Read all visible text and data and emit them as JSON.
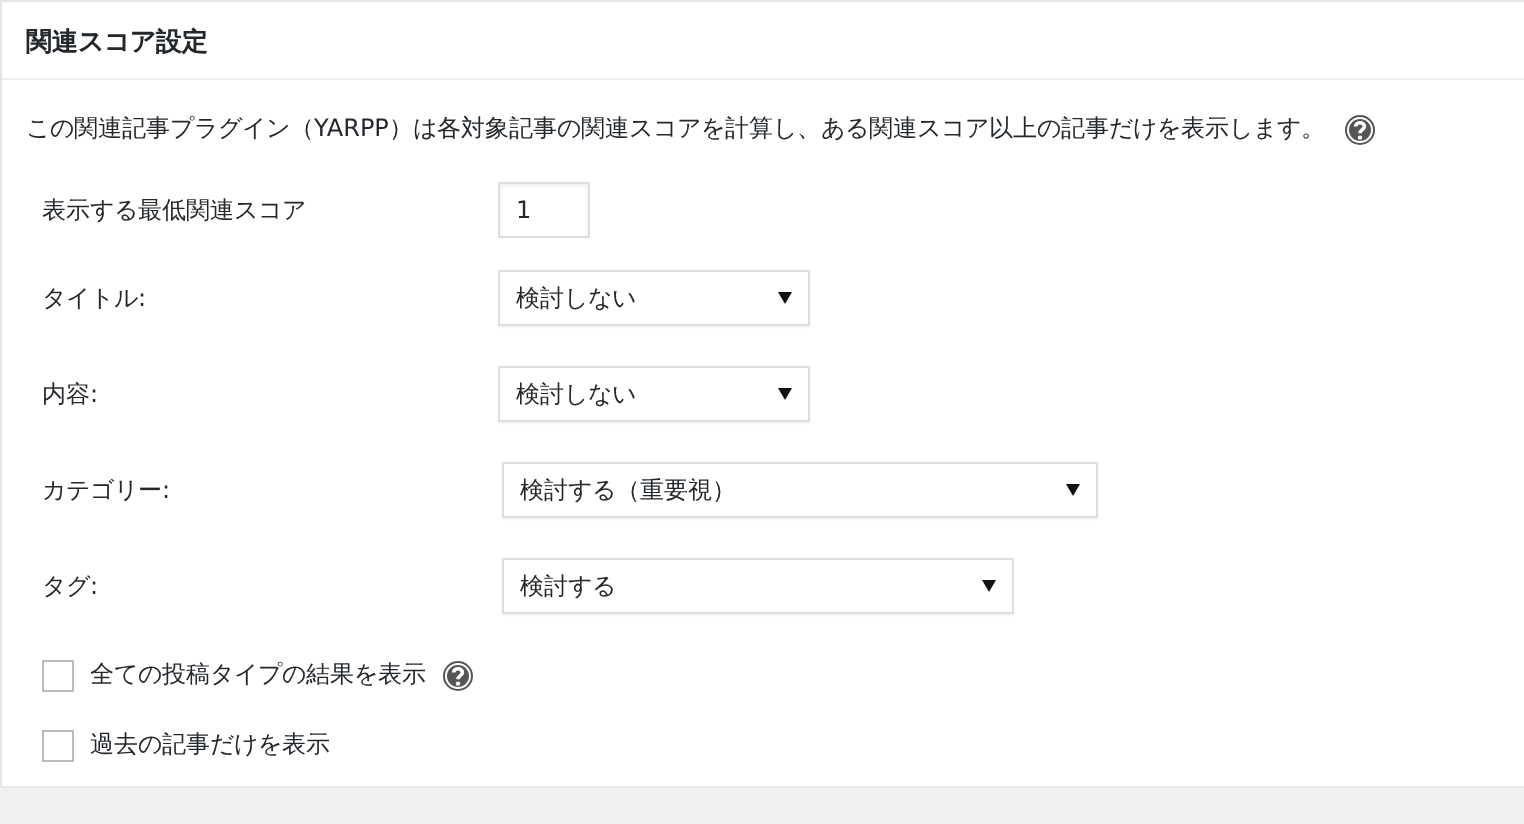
{
  "panel": {
    "title": "関連スコア設定"
  },
  "description": {
    "text": "この関連記事プラグイン（YARPP）は各対象記事の関連スコアを計算し、ある関連スコア以上の記事だけを表示します。"
  },
  "fields": [
    {
      "kind": "number",
      "label": "表示する最低関連スコア",
      "value": "1"
    },
    {
      "kind": "select",
      "label": "タイトル:",
      "value": "検討しない"
    },
    {
      "kind": "select",
      "label": "内容:",
      "value": "検討しない"
    },
    {
      "kind": "select",
      "label": "カテゴリー:",
      "value": "検討する（重要視）"
    },
    {
      "kind": "select",
      "label": "タグ:",
      "value": "検討する"
    }
  ],
  "checkboxes": [
    {
      "label": "全ての投稿タイプの結果を表示",
      "checked": false,
      "help": true
    },
    {
      "label": "過去の記事だけを表示",
      "checked": false,
      "help": false
    }
  ]
}
